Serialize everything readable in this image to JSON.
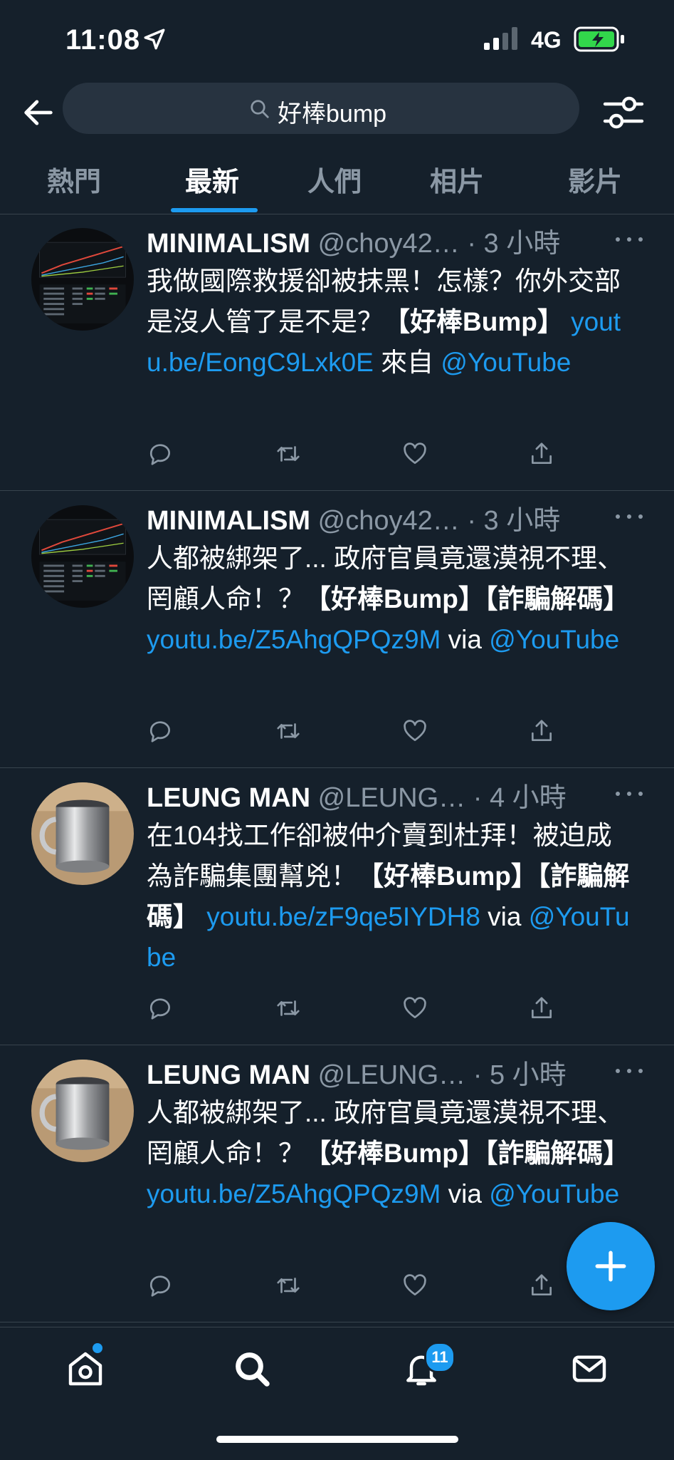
{
  "status_bar": {
    "time": "11:08",
    "network": "4G"
  },
  "search": {
    "query": "好棒bump"
  },
  "tabs": [
    {
      "label": "熱門"
    },
    {
      "label": "最新",
      "active": true
    },
    {
      "label": "人們"
    },
    {
      "label": "相片"
    },
    {
      "label": "影片"
    }
  ],
  "tweets": [
    {
      "name": "MINIMALISM",
      "handle": "@choy42…",
      "time": "· 3 小時",
      "body": [
        {
          "t": "我做國際救援卻被抹黑！怎樣？你外交部是沒人管了是不是？"
        },
        {
          "t": "【好棒Bump】",
          "b": true
        },
        {
          "t": " "
        },
        {
          "t": "youtu.be/EongC9Lxk0E",
          "l": true
        },
        {
          "t": " 來自 "
        },
        {
          "t": "@YouTube",
          "l": true
        }
      ]
    },
    {
      "name": "MINIMALISM",
      "handle": "@choy42…",
      "time": "· 3 小時",
      "body": [
        {
          "t": "人都被綁架了... 政府官員竟還漠視不理、罔顧人命！？"
        },
        {
          "t": "【好棒Bump】【詐騙解碼】",
          "b": true
        },
        {
          "t": " "
        },
        {
          "t": "youtu.be/Z5AhgQPQz9M",
          "l": true
        },
        {
          "t": " via "
        },
        {
          "t": "@YouTube",
          "l": true
        }
      ]
    },
    {
      "name": "LEUNG MAN",
      "handle": "@LEUNG…",
      "time": "· 4 小時",
      "body": [
        {
          "t": "在104找工作卻被仲介賣到杜拜！被迫成為詐騙集團幫兇！"
        },
        {
          "t": "【好棒Bump】【詐騙解碼】",
          "b": true
        },
        {
          "t": " "
        },
        {
          "t": "youtu.be/zF9qe5IYDH8",
          "l": true
        },
        {
          "t": " via "
        },
        {
          "t": "@YouTube",
          "l": true
        }
      ]
    },
    {
      "name": "LEUNG MAN",
      "handle": "@LEUNG…",
      "time": "· 5 小時",
      "body": [
        {
          "t": "人都被綁架了... 政府官員竟還漠視不理、罔顧人命！？"
        },
        {
          "t": "【好棒Bump】【詐騙解碼】",
          "b": true
        },
        {
          "t": " "
        },
        {
          "t": "youtu.be/Z5AhgQPQz9M",
          "l": true
        },
        {
          "t": " via "
        },
        {
          "t": "@YouTube",
          "l": true
        }
      ]
    }
  ],
  "nav": {
    "notifications_badge": "11"
  },
  "icons": [
    "back-arrow-icon",
    "search-icon",
    "filter-icon",
    "more-icon",
    "reply-icon",
    "retweet-icon",
    "like-icon",
    "share-icon",
    "compose-icon",
    "home-icon",
    "explore-icon",
    "notifications-icon",
    "messages-icon"
  ],
  "colors": {
    "background": "#15202b",
    "accent": "#1d9bf0",
    "muted": "#8b98a5",
    "divider": "#38444d"
  }
}
